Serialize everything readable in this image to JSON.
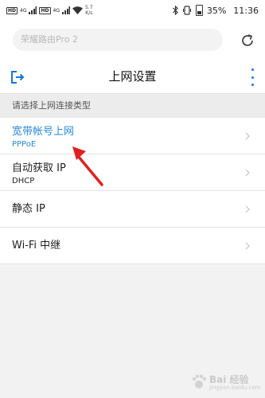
{
  "status_bar": {
    "network_badges": [
      "HD",
      "HD"
    ],
    "signal_labels": [
      "4G",
      "4G"
    ],
    "speed_value": "5.7",
    "speed_unit": "K/s",
    "battery": "35%",
    "time": "11:36"
  },
  "search": {
    "placeholder": "荣耀路由Pro 2"
  },
  "header": {
    "title": "上网设置"
  },
  "section": {
    "title": "请选择上网连接类型"
  },
  "connection_types": [
    {
      "label": "宽带帐号上网",
      "sub": "PPPoE"
    },
    {
      "label": "自动获取 IP",
      "sub": "DHCP"
    },
    {
      "label": "静态 IP"
    },
    {
      "label": "Wi-Fi 中继"
    }
  ],
  "watermark": {
    "text": "Bai 经验",
    "url": "jingyan.baidu.com"
  },
  "colors": {
    "accent": "#2a8ad6",
    "arrow": "#e02020"
  },
  "icons": [
    "wifi-icon",
    "bluetooth-icon",
    "battery-icon",
    "refresh-icon",
    "exit-icon",
    "more-vert-icon",
    "chevron-right-icon"
  ]
}
